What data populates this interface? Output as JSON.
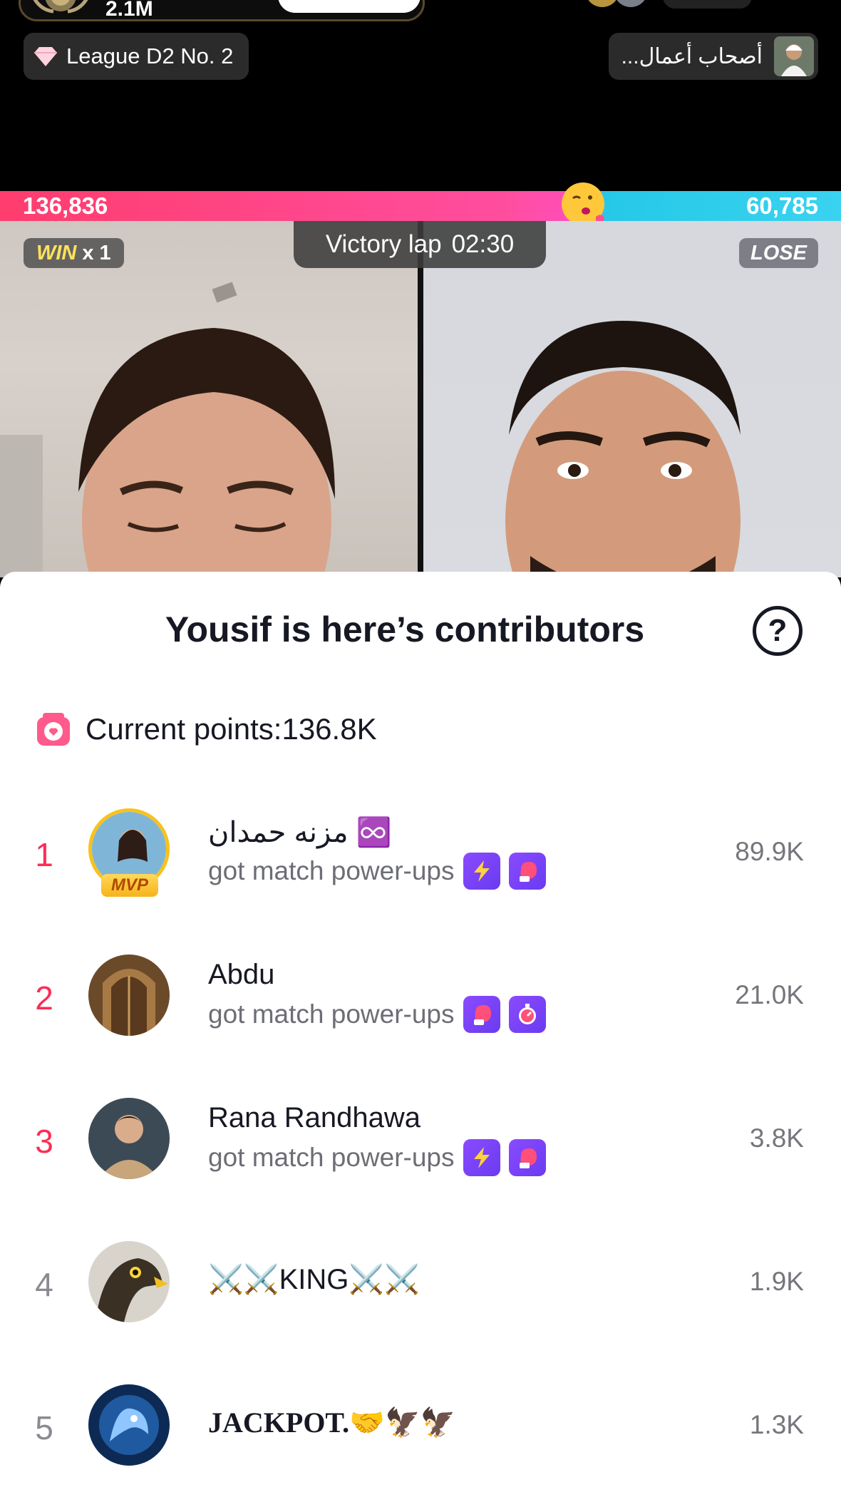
{
  "top": {
    "host_likes": "2.1M",
    "league_label": "League D2 No. 2",
    "team_label": "...أصحاب أعمال"
  },
  "battle": {
    "score_left": "136,836",
    "score_right": "60,785",
    "win_label": "WIN",
    "win_multiplier": "x 1",
    "lose_label": "LOSE",
    "victory_label": "Victory lap",
    "victory_timer": "02:30"
  },
  "sheet": {
    "title": "Yousif is here’s contributors",
    "help_symbol": "?",
    "current_points": "Current points:136.8K",
    "contributors": [
      {
        "rank": "1",
        "name": "مزنه حمدان ♾️",
        "subtitle": "got match power-ups",
        "score": "89.9K",
        "mvp": "MVP",
        "powerups": [
          "lightning-icon",
          "boxing-glove-icon"
        ]
      },
      {
        "rank": "2",
        "name": "Abdu",
        "subtitle": "got match power-ups",
        "score": "21.0K",
        "powerups": [
          "boxing-glove-icon",
          "stopwatch-icon"
        ]
      },
      {
        "rank": "3",
        "name": "Rana Randhawa",
        "subtitle": "got match power-ups",
        "score": "3.8K",
        "powerups": [
          "lightning-icon",
          "boxing-glove-icon"
        ]
      },
      {
        "rank": "4",
        "name": "⚔️⚔️KING⚔️⚔️",
        "score": "1.9K"
      },
      {
        "rank": "5",
        "name": "JACKPOT.🤝🦅🦅",
        "score": "1.3K"
      }
    ]
  },
  "colors": {
    "accent": "#fe2c55",
    "cyan": "#26c8e8",
    "powerup": "#7b45f8"
  }
}
